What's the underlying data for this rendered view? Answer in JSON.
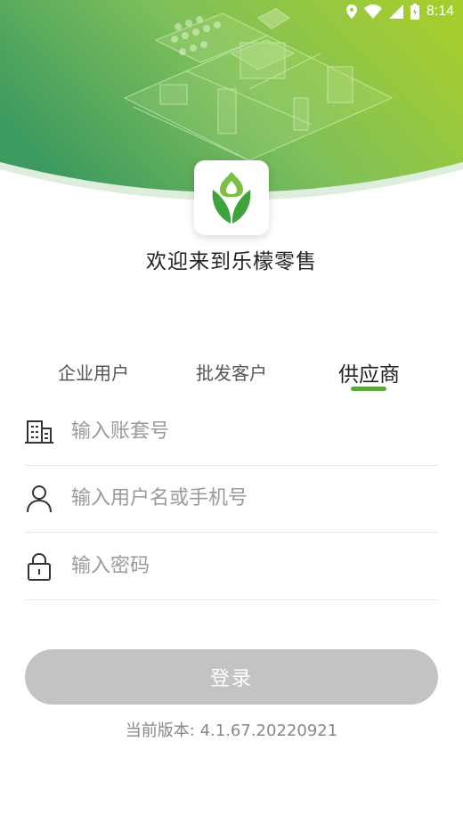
{
  "status_bar": {
    "time": "8:14",
    "icons": [
      "location-icon",
      "wifi-icon",
      "signal-icon",
      "battery-icon"
    ]
  },
  "header": {
    "welcome_text": "欢迎来到乐檬零售"
  },
  "tabs": [
    {
      "label": "企业用户",
      "selected": false
    },
    {
      "label": "批发客户",
      "selected": false
    },
    {
      "label": "供应商",
      "selected": true
    }
  ],
  "form": {
    "account_set": {
      "placeholder": "输入账套号",
      "value": ""
    },
    "username": {
      "placeholder": "输入用户名或手机号",
      "value": ""
    },
    "password": {
      "placeholder": "输入密码",
      "value": ""
    }
  },
  "login_button": {
    "label": "登录",
    "enabled": false
  },
  "version": "当前版本: 4.1.67.20220921",
  "colors": {
    "header_green_dark": "#3d9a5f",
    "header_green_light": "#9cc832",
    "accent": "#5aa93d",
    "button_disabled": "#c3c3c3"
  }
}
